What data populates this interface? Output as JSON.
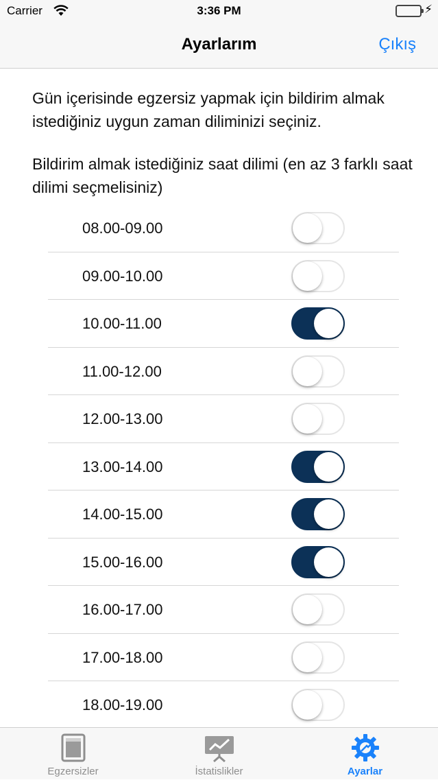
{
  "status_bar": {
    "carrier": "Carrier",
    "time": "3:36 PM"
  },
  "nav": {
    "title": "Ayarlarım",
    "action": "Çıkış"
  },
  "description": "Gün içerisinde egzersiz yapmak için bildirim almak istediğiniz uygun zaman diliminizi seçiniz.",
  "subtitle": "Bildirim almak istediğiniz saat dilimi (en az 3 farklı saat dilimi seçmelisiniz)",
  "time_slots": [
    {
      "label": "08.00-09.00",
      "on": false
    },
    {
      "label": "09.00-10.00",
      "on": false
    },
    {
      "label": "10.00-11.00",
      "on": true
    },
    {
      "label": "11.00-12.00",
      "on": false
    },
    {
      "label": "12.00-13.00",
      "on": false
    },
    {
      "label": "13.00-14.00",
      "on": true
    },
    {
      "label": "14.00-15.00",
      "on": true
    },
    {
      "label": "15.00-16.00",
      "on": true
    },
    {
      "label": "16.00-17.00",
      "on": false
    },
    {
      "label": "17.00-18.00",
      "on": false
    },
    {
      "label": "18.00-19.00",
      "on": false
    }
  ],
  "tabs": [
    {
      "label": "Egzersizler",
      "icon": "book-icon",
      "active": false
    },
    {
      "label": "İstatislikler",
      "icon": "chart-board-icon",
      "active": false
    },
    {
      "label": "Ayarlar",
      "icon": "gear-icon",
      "active": true
    }
  ],
  "colors": {
    "accent": "#1a82fb",
    "toggle_on": "#0c3157",
    "battery": "#4cd964",
    "tab_inactive": "#8e8e8e"
  }
}
